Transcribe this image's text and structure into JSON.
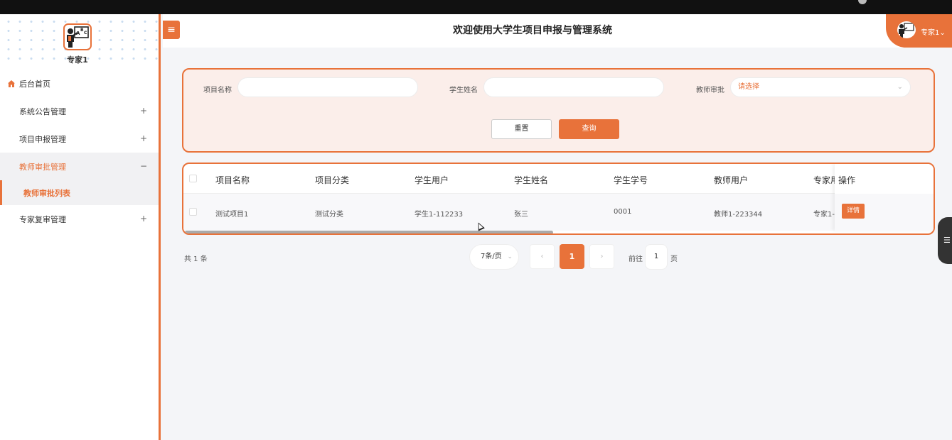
{
  "header": {
    "title": "欢迎使用大学生项目申报与管理系统",
    "menu_icon": "≡",
    "user_name": "专家1",
    "user_caret": "⌄"
  },
  "sidebar": {
    "user_name": "专家1",
    "items": [
      {
        "label": "后台首页",
        "icon": "home-icon",
        "sign": ""
      },
      {
        "label": "系统公告管理",
        "icon": "grid-icon",
        "sign": "+"
      },
      {
        "label": "项目申报管理",
        "icon": "grid-icon",
        "sign": "+"
      },
      {
        "label": "教师审批管理",
        "icon": "grid-icon",
        "sign": "−"
      },
      {
        "label": "专家复审管理",
        "icon": "grid-icon",
        "sign": "+"
      }
    ],
    "sub_item": "教师审批列表"
  },
  "search": {
    "project_name_label": "项目名称",
    "student_name_label": "学生姓名",
    "teacher_approval_label": "教师审批",
    "teacher_approval_placeholder": "请选择",
    "reset_label": "重置",
    "query_label": "查询"
  },
  "table": {
    "columns": [
      "项目名称",
      "项目分类",
      "学生用户",
      "学生姓名",
      "学生学号",
      "教师用户",
      "专家用",
      "操作"
    ],
    "rows": [
      {
        "cells": [
          "测试项目1",
          "测试分类",
          "学生1-112233",
          "张三",
          "0001",
          "教师1-223344",
          "专家1-"
        ],
        "action": "详情"
      }
    ]
  },
  "pagination": {
    "total": "共 1 条",
    "page_size": "7条/页",
    "prev": "‹",
    "current": "1",
    "next": "›",
    "goto_prefix": "前往",
    "goto_value": "1",
    "goto_suffix": "页"
  },
  "colors": {
    "accent": "#e8723a",
    "panel_bg": "#fbeeea"
  }
}
